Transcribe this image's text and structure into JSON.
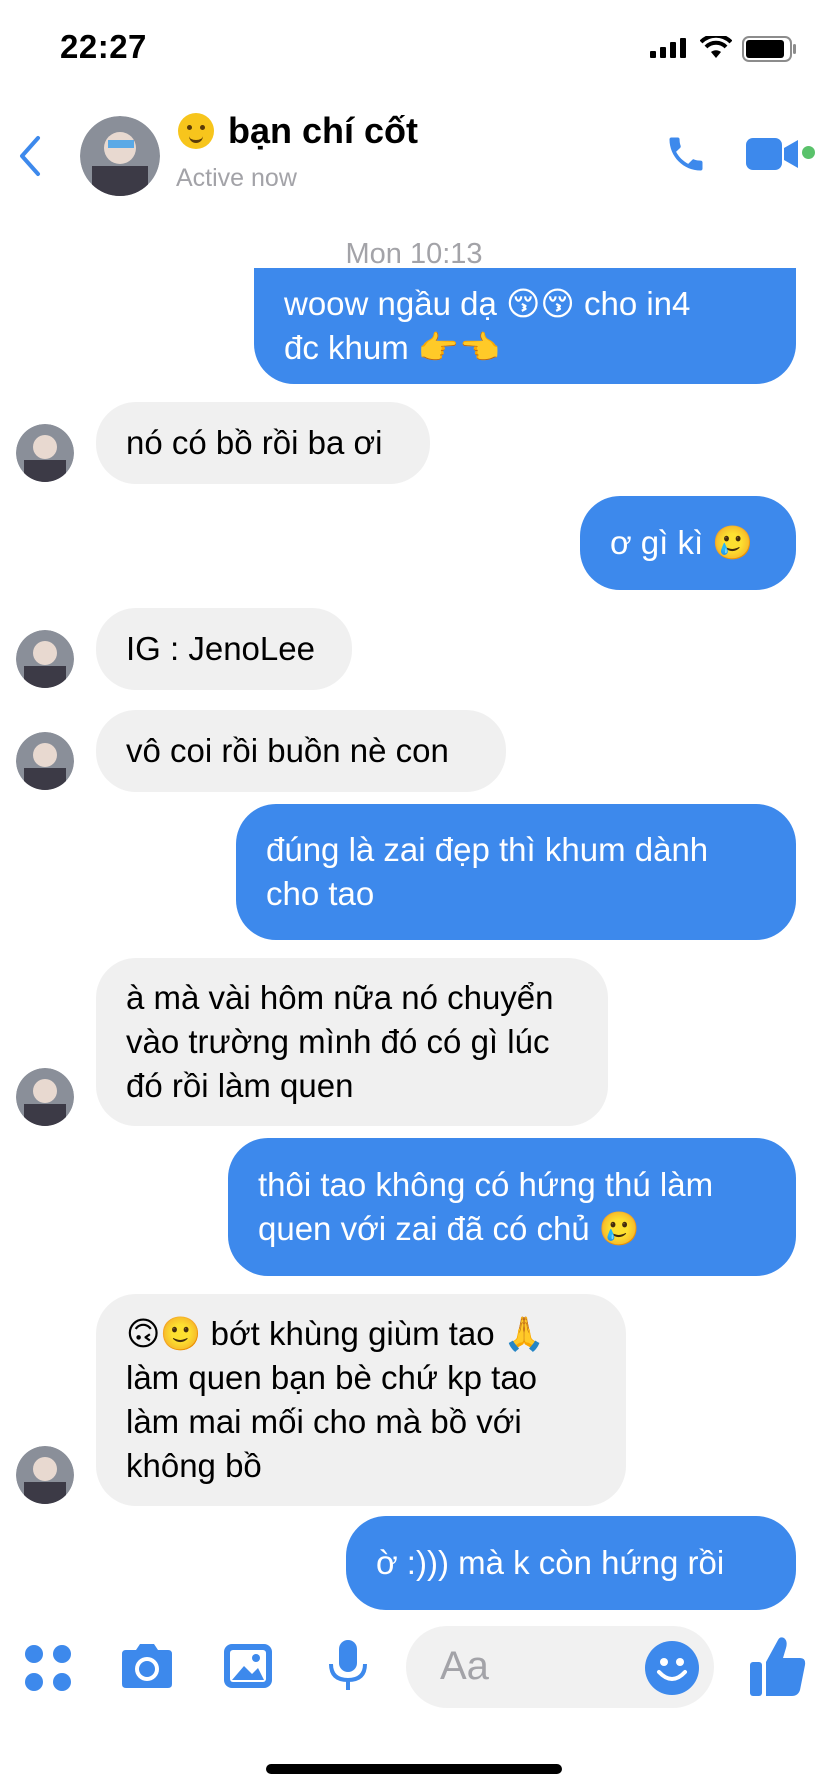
{
  "status_bar": {
    "time": "22:27"
  },
  "header": {
    "name": "bạn chí cốt",
    "name_emoji": "smirk-emoji",
    "status": "Active now"
  },
  "timestamp": "Mon 10:13",
  "messages": [
    {
      "side": "out",
      "lines": [
        "woow ngầu dạ 😚😚 cho in4",
        "đc khum 👉👈"
      ]
    },
    {
      "side": "in",
      "lines": [
        "nó có bồ rồi ba ơi"
      ]
    },
    {
      "side": "out",
      "lines": [
        "ơ gì kì 🥲"
      ]
    },
    {
      "side": "in",
      "lines": [
        "IG : JenoLee"
      ]
    },
    {
      "side": "in",
      "lines": [
        "vô coi rồi buồn nè con"
      ]
    },
    {
      "side": "out",
      "lines": [
        "đúng là zai đẹp thì khum dành",
        "cho tao"
      ]
    },
    {
      "side": "in",
      "lines": [
        "à mà vài hôm nữa nó chuyển",
        "vào trường mình đó có gì lúc",
        "đó rồi làm quen"
      ]
    },
    {
      "side": "out",
      "lines": [
        "thôi tao không có hứng thú làm",
        "quen với zai đã có chủ 🥲"
      ]
    },
    {
      "side": "in",
      "lines": [
        "🙃🙂 bớt khùng giùm tao 🙏",
        "làm quen bạn bè chứ kp tao",
        "làm mai mối cho mà bồ với",
        "không bồ"
      ]
    },
    {
      "side": "out",
      "lines": [
        "ờ :))) mà k còn hứng rồi"
      ]
    }
  ],
  "composer": {
    "placeholder": "Aa"
  },
  "colors": {
    "accent": "#3d89ec",
    "incoming": "#f0f0f0",
    "online": "#5ac26b"
  }
}
